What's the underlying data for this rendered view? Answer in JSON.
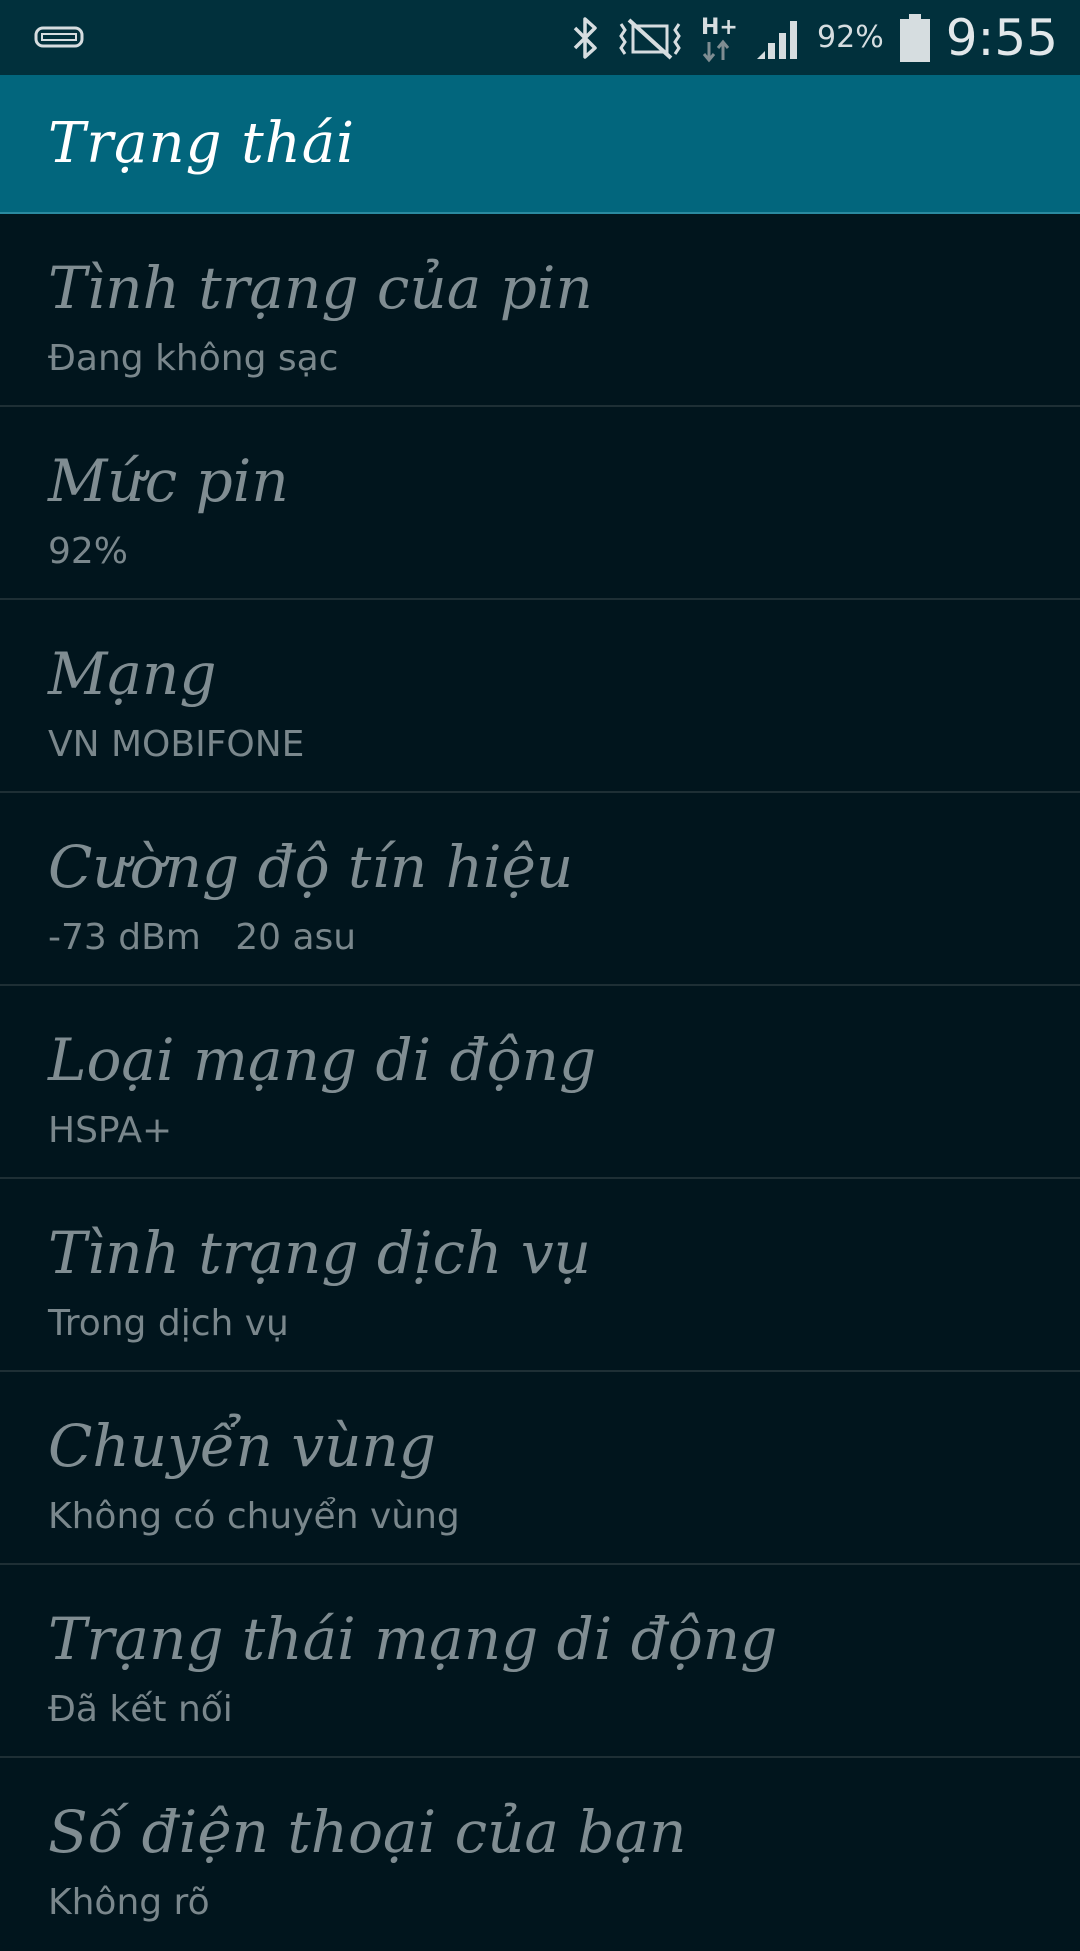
{
  "status_bar": {
    "battery_percent_text": "92%",
    "time": "9:55",
    "network_type": "H+",
    "icons": [
      "screen-mirroring-icon",
      "bluetooth-icon",
      "mute-vibrate-icon",
      "data-hplus-icon",
      "signal-icon",
      "battery-icon"
    ],
    "icon_color": "#d6dde0"
  },
  "action_bar": {
    "title": "Trạng thái",
    "background": "#02667d"
  },
  "items": [
    {
      "title": "Tình trạng của pin",
      "subtitle": "Đang không sạc"
    },
    {
      "title": "Mức pin",
      "subtitle": "92%"
    },
    {
      "title": "Mạng",
      "subtitle": "VN MOBIFONE"
    },
    {
      "title": "Cường độ tín hiệu",
      "subtitle": "-73 dBm   20 asu"
    },
    {
      "title": "Loại mạng di động",
      "subtitle": "HSPA+"
    },
    {
      "title": "Tình trạng dịch vụ",
      "subtitle": "Trong dịch vụ"
    },
    {
      "title": "Chuyển vùng",
      "subtitle": "Không có chuyển vùng"
    },
    {
      "title": "Trạng thái mạng di động",
      "subtitle": "Đã kết nối"
    },
    {
      "title": "Số điện thoại của bạn",
      "subtitle": "Không rõ"
    }
  ],
  "colors": {
    "background": "#01151d",
    "status_bar": "#01303c",
    "divider": "#1e2f35",
    "text": "#808d92"
  }
}
